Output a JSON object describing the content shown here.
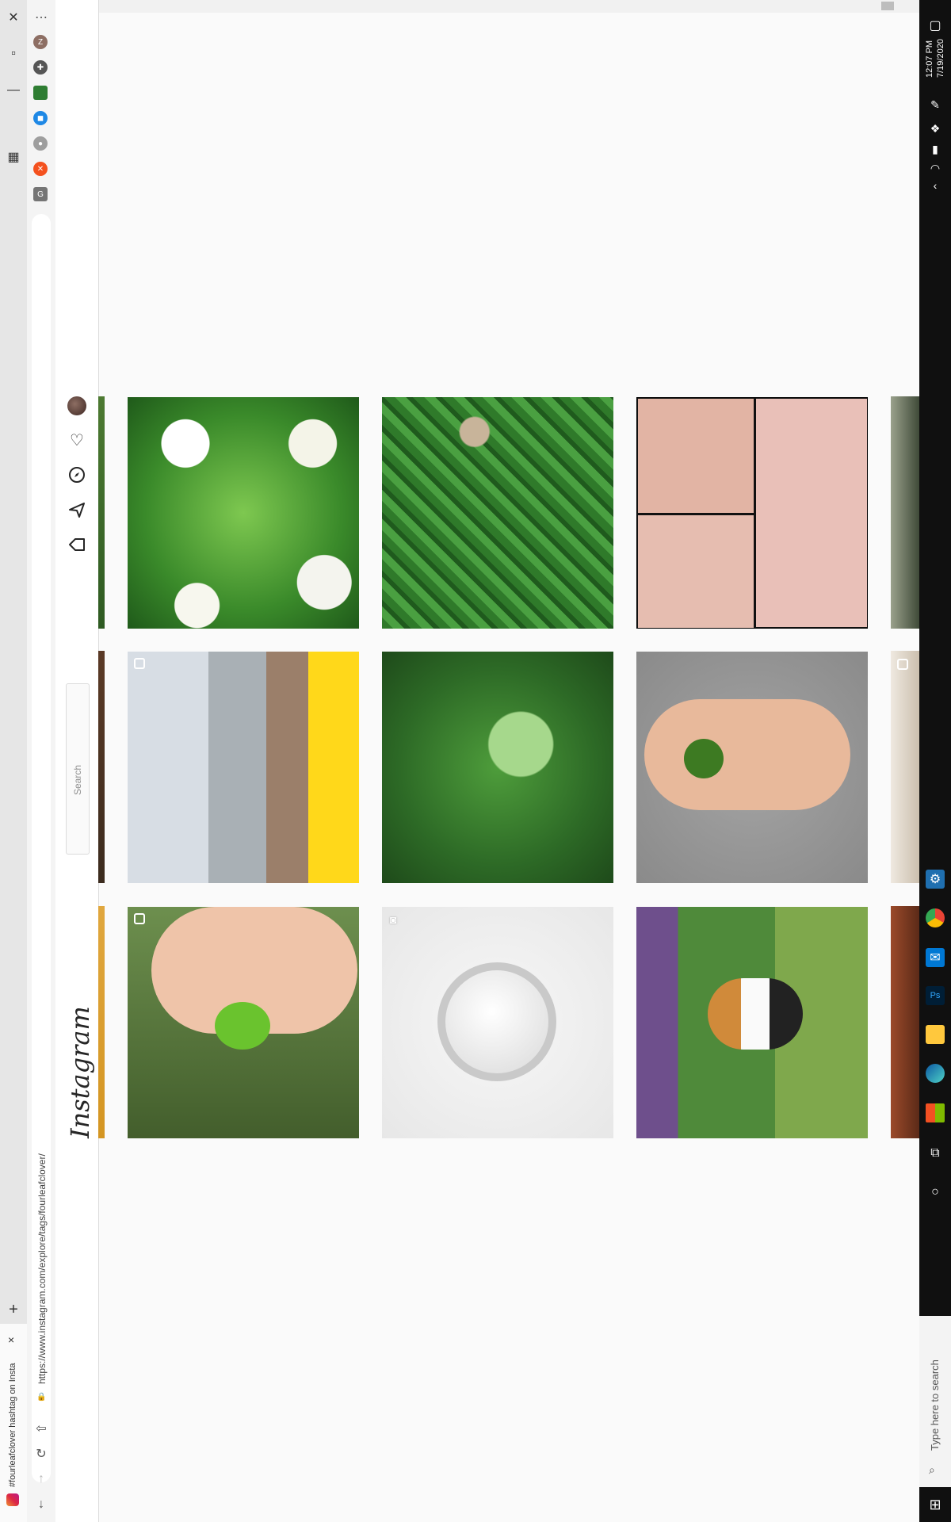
{
  "browser": {
    "tab_title": "#fourleafclover hashtag on Insta",
    "url": "https://www.instagram.com/explore/tags/fourleafclover/",
    "new_tab": "+",
    "close_tab": "×"
  },
  "instagram": {
    "logo": "Instagram",
    "search_placeholder": "Search",
    "nav_icons": [
      "home-icon",
      "direct-icon",
      "explore-icon",
      "heart-icon",
      "profile-avatar"
    ]
  },
  "grid": {
    "rows": [
      [
        "clover flowers with four-leaf clover",
        "clover in grass",
        "tattoo collage"
      ],
      [
        "yellow submarine street",
        "dewy four-leaf clover",
        "four-leaf clover on hand"
      ],
      [
        "holding clover",
        "pearl pendant",
        "calico cat in garden"
      ]
    ]
  },
  "taskbar": {
    "time": "12:07 PM",
    "date": "7/19/2020",
    "search_placeholder": "Type here to search"
  },
  "colors": {
    "accent": "#0095f6",
    "taskbar": "#101010",
    "background": "#fafafa"
  }
}
